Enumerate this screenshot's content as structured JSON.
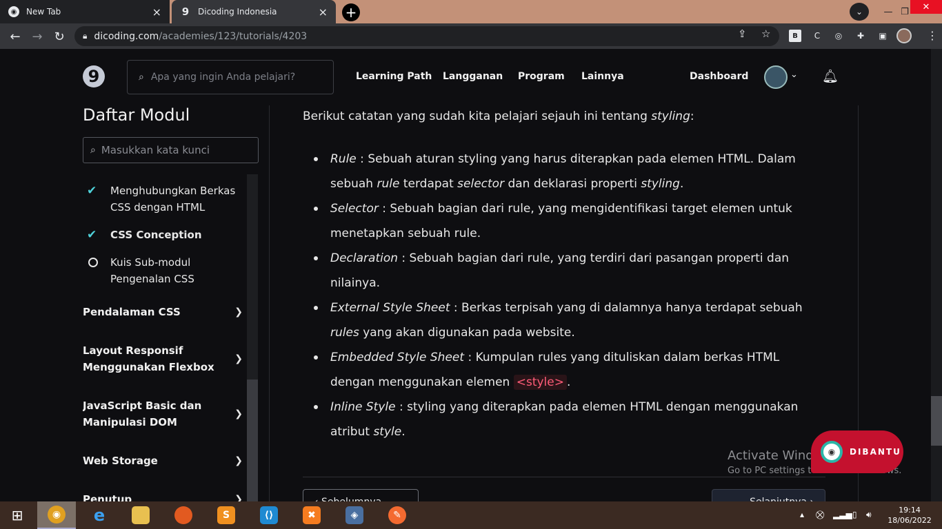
{
  "browser": {
    "tabs": [
      {
        "title": "New Tab",
        "close": "×"
      },
      {
        "title": "Dicoding Indonesia",
        "close": "×",
        "favicon": "9"
      }
    ],
    "new_tab": "+",
    "url_domain": "dicoding.com",
    "url_path": "/academies/123/tutorials/4203",
    "window_controls": {
      "minimize": "—",
      "maximize": "❐",
      "close": "✕"
    }
  },
  "site": {
    "logo": "9",
    "search_placeholder": "Apa yang ingin Anda pelajari?",
    "nav": [
      "Learning Path",
      "Langganan",
      "Program",
      "Lainnya"
    ],
    "dashboard": "Dashboard"
  },
  "sidebar": {
    "title": "Daftar Modul",
    "search_placeholder": "Masukkan kata kunci",
    "lessons": [
      {
        "label": "Menghubungkan Berkas CSS dengan HTML",
        "status": "done"
      },
      {
        "label": "CSS Conception",
        "status": "current"
      },
      {
        "label": "Kuis Sub-modul Pengenalan CSS",
        "status": "pending"
      }
    ],
    "modules": [
      "Pendalaman CSS",
      "Layout Responsif Menggunakan Flexbox",
      "JavaScript Basic dan Manipulasi DOM",
      "Web Storage",
      "Penutup"
    ]
  },
  "content": {
    "intro_text": "Berikut catatan yang sudah kita pelajari sejauh ini tentang ",
    "intro_em": "styling",
    "intro_end": ":",
    "items": [
      {
        "term": "Rule",
        "p1": " : Sebuah aturan styling yang harus diterapkan pada elemen HTML. Dalam sebuah ",
        "em1": "rule",
        "p2": " terdapat ",
        "em2": "selector",
        "p3": " dan deklarasi properti ",
        "em3": "styling",
        "p4": "."
      },
      {
        "term": "Selector",
        "text": " : Sebuah bagian dari rule, yang mengidentifikasi target elemen untuk menetapkan sebuah rule."
      },
      {
        "term": "Declaration",
        "text": " : Sebuah bagian dari rule, yang terdiri dari pasangan properti dan nilainya."
      },
      {
        "term": "External Style Sheet",
        "p1": " : Berkas terpisah yang di dalamnya hanya terdapat sebuah ",
        "em1": "rules",
        "p2": " yang akan digunakan pada website."
      },
      {
        "term": "Embedded Style Sheet",
        "p1": " : Kumpulan rules yang dituliskan dalam berkas HTML dengan menggunakan elemen ",
        "code": "<style>",
        "p2": "."
      },
      {
        "term": "Inline Style",
        "p1": " : styling yang diterapkan pada elemen HTML dengan menggunakan atribut ",
        "em1": "style",
        "p2": "."
      }
    ],
    "prev_label": "‹ Sebelumnya",
    "next_label": "Selanjutnya ›"
  },
  "overlay": {
    "activate_title": "Activate Windows",
    "activate_sub": "Go to PC settings to activate Windows.",
    "dibantu_label": "DIBANTU"
  },
  "taskbar": {
    "time": "19:14",
    "date": "18/06/2022"
  },
  "colors": {
    "accent_check": "#4fd1d9",
    "code_red": "#ff5c78",
    "dibantu_red": "#c4112e"
  }
}
